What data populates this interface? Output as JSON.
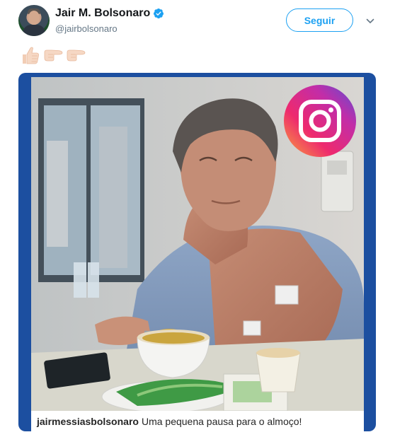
{
  "tweet": {
    "author": {
      "display_name": "Jair M. Bolsonaro",
      "handle": "@jairbolsonaro",
      "verified": true
    },
    "follow_label": "Seguir",
    "emoji_icons": [
      "thumbs-up-icon",
      "pointing-right-icon",
      "pointing-right-icon"
    ],
    "media": {
      "overlay_icon": "instagram-icon",
      "caption_user": "jairmessiasbolsonaro",
      "caption_text": "Uma pequena pausa para o almoço!"
    }
  },
  "colors": {
    "accent": "#1da1f2",
    "frame": "#1c4fa0",
    "handle_text": "#657786"
  }
}
